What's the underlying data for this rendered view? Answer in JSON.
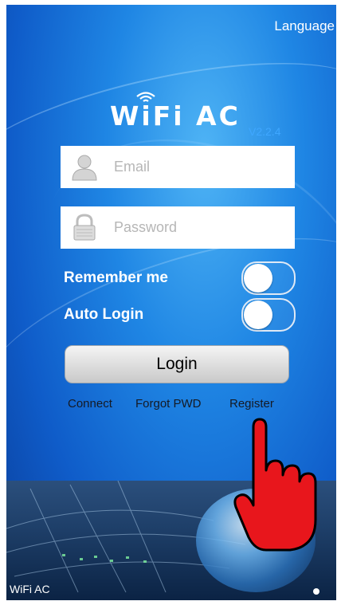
{
  "header": {
    "language_label": "Language"
  },
  "logo": {
    "text": "WiFi AC",
    "version": "V2.2.4"
  },
  "form": {
    "email_placeholder": "Email",
    "password_placeholder": "Password"
  },
  "options": {
    "remember_label": "Remember me",
    "auto_login_label": "Auto Login"
  },
  "actions": {
    "login_label": "Login",
    "connect_label": "Connect",
    "forgot_label": "Forgot PWD",
    "register_label": "Register"
  },
  "banner": {
    "caption": "WiFi AC"
  },
  "colors": {
    "background": "#1f86e4",
    "version_text": "#3fa7ff",
    "hand": "#e8161c"
  },
  "icons": [
    "wifi-icon",
    "user-icon",
    "lock-icon",
    "pointing-hand-icon"
  ]
}
